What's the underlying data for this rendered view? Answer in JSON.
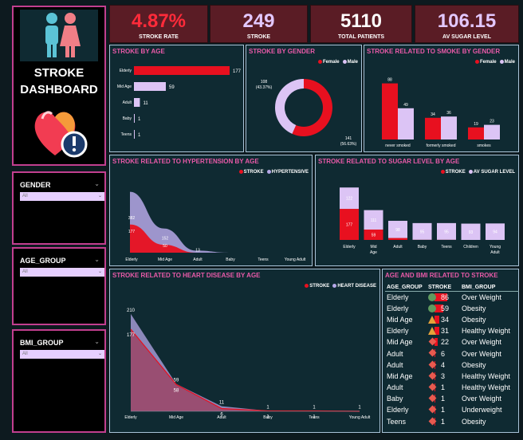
{
  "sidebar": {
    "title_line1": "STROKE",
    "title_line2": "DASHBOARD"
  },
  "kpis": [
    {
      "value": "4.87%",
      "label": "STROKE RATE",
      "color": "#ff2b3a"
    },
    {
      "value": "249",
      "label": "STROKE",
      "color": "#e3c8ff"
    },
    {
      "value": "5110",
      "label": "TOTAL PATIENTS",
      "color": "#ffffff"
    },
    {
      "value": "106.15",
      "label": "AV SUGAR LEVEL",
      "color": "#e3c8ff"
    }
  ],
  "slicers": [
    {
      "label": "GENDER",
      "value": "All"
    },
    {
      "label": "AGE_GROUP",
      "value": "All"
    },
    {
      "label": "BMI_GROUP",
      "value": "All"
    }
  ],
  "colors": {
    "stroke_red": "#e8101f",
    "lavender": "#dcc4f5",
    "pink": "#e85aa8"
  },
  "chart_data": [
    {
      "id": "stroke_by_age",
      "type": "bar",
      "title": "STROKE BY AGE",
      "categories": [
        "Elderly",
        "Mid Age",
        "Adult",
        "Baby",
        "Teens"
      ],
      "values": [
        177,
        59,
        11,
        1,
        1
      ]
    },
    {
      "id": "stroke_by_gender",
      "type": "pie",
      "title": "STROKE BY GENDER",
      "legend": [
        "Female",
        "Male"
      ],
      "slices": [
        {
          "name": "Female",
          "value": 141,
          "pct_label": "(56.63%)"
        },
        {
          "name": "Male",
          "value": 108,
          "pct_label": "(43.37%)"
        }
      ]
    },
    {
      "id": "stroke_smoke_gender",
      "type": "bar",
      "title": "STROKE RELATED TO SMOKE BY GENDER",
      "categories": [
        "never smoked",
        "formerly smoked",
        "smokes"
      ],
      "series": [
        {
          "name": "Female",
          "values": [
            88,
            34,
            19
          ]
        },
        {
          "name": "Male",
          "values": [
            49,
            36,
            23
          ]
        }
      ]
    },
    {
      "id": "stroke_hypertension_age",
      "type": "area",
      "title": "STROKE RELATED TO HYPERTENSION BY AGE",
      "categories": [
        "Elderly",
        "Mid Age",
        "Adult",
        "Baby",
        "Teens",
        "Young Adult"
      ],
      "series": [
        {
          "name": "STROKE",
          "values": [
            177,
            50,
            0,
            0,
            0,
            0
          ]
        },
        {
          "name": "HYPERTENSIVE",
          "values": [
            382,
            152,
            13,
            0,
            0,
            0
          ]
        }
      ],
      "data_labels": [
        {
          "series": "HYPERTENSIVE",
          "index": 0,
          "text": "382"
        },
        {
          "series": "STROKE",
          "index": 0,
          "text": "177"
        },
        {
          "series": "HYPERTENSIVE",
          "index": 1,
          "text": "152"
        },
        {
          "series": "STROKE",
          "index": 1,
          "text": "50"
        },
        {
          "series": "HYPERTENSIVE",
          "index": 2,
          "text": "13"
        }
      ]
    },
    {
      "id": "stroke_sugar_age",
      "type": "bar",
      "title": "STROKE RELATED TO SUGAR LEVEL BY AGE",
      "categories": [
        "Elderly",
        "Mid Age",
        "Adult",
        "Baby",
        "Teens",
        "Children",
        "Young Adult"
      ],
      "series": [
        {
          "name": "STROKE",
          "values": [
            177,
            59,
            11,
            1,
            1,
            0,
            0
          ]
        },
        {
          "name": "AV SUGAR LEVEL",
          "values": [
            122,
            111,
            98,
            95,
            95,
            93,
            94
          ]
        }
      ],
      "stroke_labels": [
        "177",
        "59",
        "",
        "",
        "",
        "",
        ""
      ]
    },
    {
      "id": "stroke_heart_age",
      "type": "area",
      "title": "STROKE RELATED TO HEART DISEASE BY AGE",
      "categories": [
        "Elderly",
        "Mid Age",
        "Adult",
        "Baby",
        "Teens",
        "Young Adult"
      ],
      "series": [
        {
          "name": "STROKE",
          "values": [
            177,
            58,
            6,
            1,
            1,
            0
          ]
        },
        {
          "name": "HEART DISEASE",
          "values": [
            210,
            59,
            11,
            1,
            1,
            1
          ]
        }
      ]
    },
    {
      "id": "age_bmi_table",
      "type": "table",
      "title": "AGE AND BMI RELATED TO STROKE",
      "columns": [
        "AGE_GROUP",
        "STROKE",
        "BMI_GROUP"
      ],
      "rows": [
        {
          "age": "Elderly",
          "stroke": "86",
          "bmi": "Over Weight",
          "kpi": "circle"
        },
        {
          "age": "Elderly",
          "stroke": "59",
          "bmi": "Obesity",
          "kpi": "circle"
        },
        {
          "age": "Mid Age",
          "stroke": "34",
          "bmi": "Obesity",
          "kpi": "triangle"
        },
        {
          "age": "Elderly",
          "stroke": "31",
          "bmi": "Healthy Weight",
          "kpi": "triangle"
        },
        {
          "age": "Mid Age",
          "stroke": "22",
          "bmi": "Over Weight",
          "kpi": "diamond"
        },
        {
          "age": "Adult",
          "stroke": "6",
          "bmi": "Over Weight",
          "kpi": "diamond"
        },
        {
          "age": "Adult",
          "stroke": "4",
          "bmi": "Obesity",
          "kpi": "diamond"
        },
        {
          "age": "Mid Age",
          "stroke": "3",
          "bmi": "Healthy Weight",
          "kpi": "diamond"
        },
        {
          "age": "Adult",
          "stroke": "1",
          "bmi": "Healthy Weight",
          "kpi": "diamond"
        },
        {
          "age": "Baby",
          "stroke": "1",
          "bmi": "Over Weight",
          "kpi": "diamond"
        },
        {
          "age": "Elderly",
          "stroke": "1",
          "bmi": "Underweight",
          "kpi": "diamond"
        },
        {
          "age": "Teens",
          "stroke": "1",
          "bmi": "Obesity",
          "kpi": "diamond"
        }
      ]
    }
  ]
}
